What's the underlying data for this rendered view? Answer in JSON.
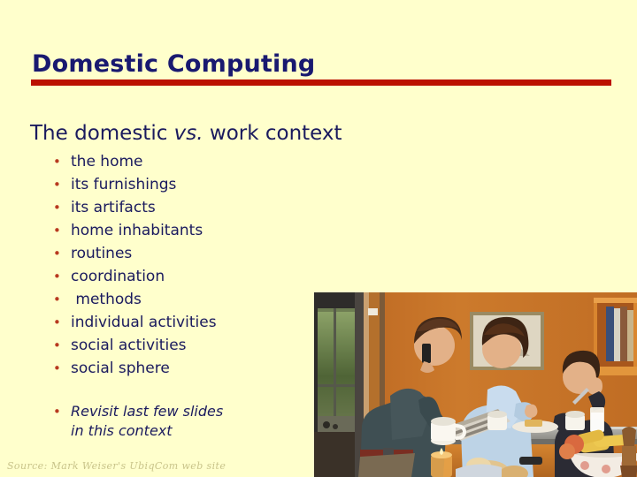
{
  "slide": {
    "title": "Domestic Computing",
    "subtitle": {
      "before": "The domestic ",
      "italic": "vs.",
      "after": " work context"
    },
    "bullets": [
      {
        "marker": "•",
        "label": "the home"
      },
      {
        "marker": "•",
        "label": "its furnishings"
      },
      {
        "marker": "•",
        "label": "its artifacts"
      },
      {
        "marker": "•",
        "label": "home inhabitants"
      },
      {
        "marker": "•",
        "label": "routines"
      },
      {
        "marker": "•",
        "label": "coordination"
      },
      {
        "marker": "•",
        "label": " methods"
      },
      {
        "marker": "•",
        "label": "individual activities"
      },
      {
        "marker": "•",
        "label": "social activities"
      },
      {
        "marker": "•",
        "label": "social sphere"
      }
    ],
    "revisit_note": {
      "marker": "•",
      "line1": "Revisit last few slides",
      "line2": "in this context"
    },
    "source_credit": "Source: Mark Weiser's UbiqCom web site",
    "photo": {
      "caption": "Family at a kitchen counter: man on mobile phone, woman reading newspaper, boy with cup",
      "colors": {
        "wall": "#c8742a",
        "wall_dark": "#a85c20",
        "window_frame": "#3a3a38",
        "foliage": "#5a6b3c",
        "counter": "#9a9a95",
        "cabinet": "#c97a2c",
        "man_shirt": "#3a4a4e",
        "woman_shirt": "#b9cfe2",
        "boy_shirt": "#2a2a33",
        "skin": "#e0b088",
        "hair_dark": "#3a2418",
        "frame_art": "#8a7a5a",
        "bowl": "#efe6dd",
        "corn": "#e8c24a"
      }
    },
    "theme": {
      "background": "#ffffcc",
      "title_color": "#191970",
      "rule_color": "#bb1100",
      "bullet_color": "#b83a20",
      "body_text_color": "#1a1a5e",
      "credit_color": "#c9c48a"
    }
  }
}
